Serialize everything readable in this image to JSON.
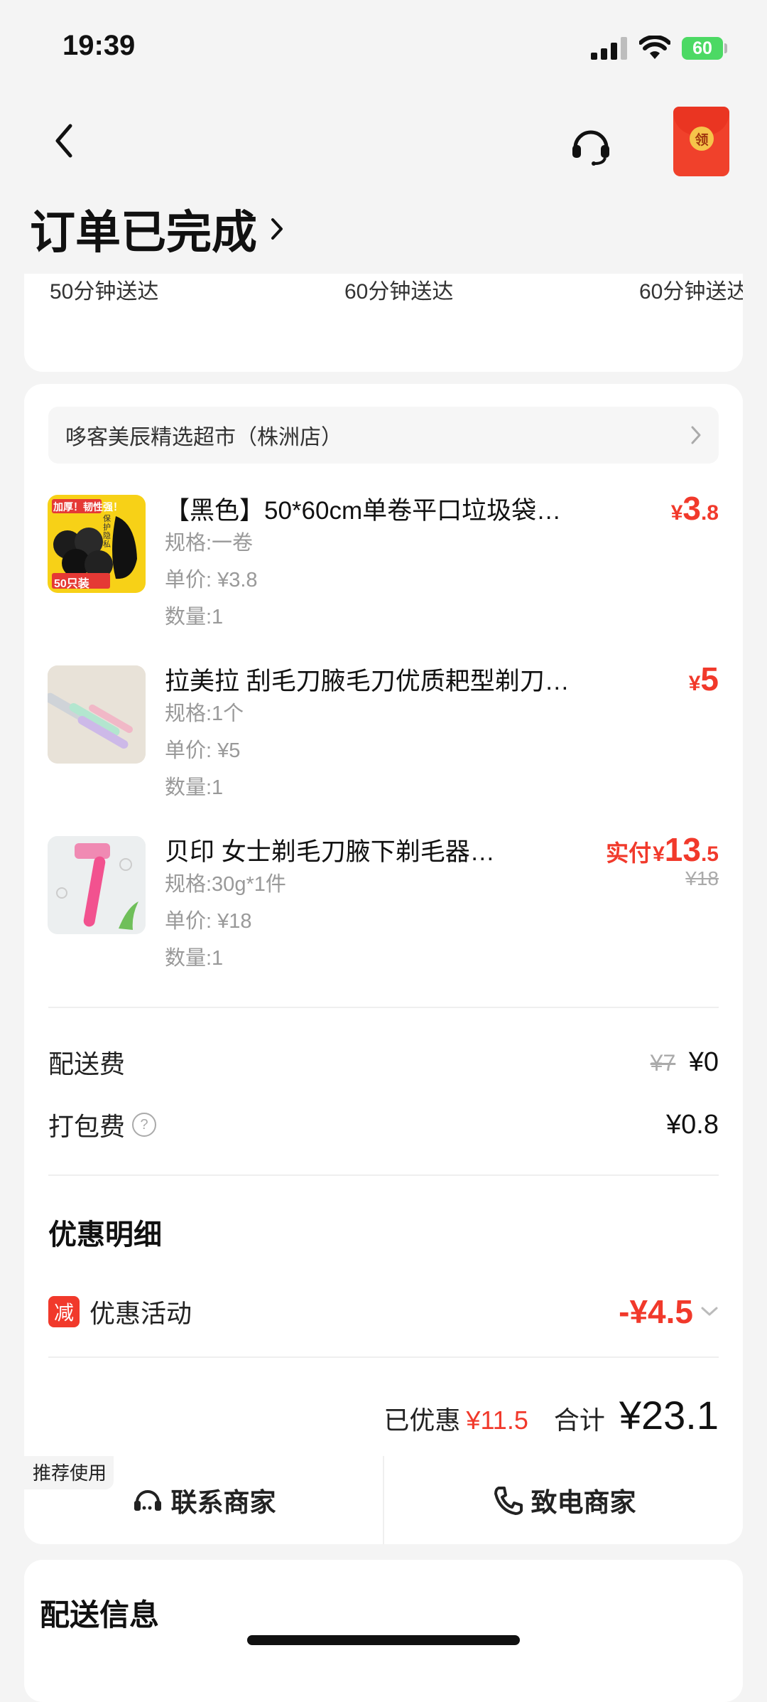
{
  "status_bar": {
    "time": "19:39",
    "battery": "60"
  },
  "header": {
    "title": "订单已完成",
    "redpacket_label": "领",
    "icons": {
      "back": "chevron-left-icon",
      "support": "headset-icon",
      "redpacket": "red-packet-icon"
    }
  },
  "delivery_options": [
    "50分钟送达",
    "60分钟送达",
    "60分钟送达"
  ],
  "store": {
    "name": "哆客美辰精选超市（株洲店）"
  },
  "items": [
    {
      "name": "【黑色】50*60cm单卷平口垃圾袋…",
      "spec": "规格:一卷",
      "unit_price": "单价: ¥3.8",
      "qty": "数量:1",
      "price_currency": "¥",
      "price_int": "3",
      "price_dec": ".8",
      "thumb_texts": [
        "加厚！韧性强！",
        "保护隐私",
        "50只装"
      ]
    },
    {
      "name": "拉美拉 刮毛刀腋毛刀优质耙型剃刀…",
      "spec": "规格:1个",
      "unit_price": "单价: ¥5",
      "qty": "数量:1",
      "price_currency": "¥",
      "price_int": "5",
      "price_dec": ""
    },
    {
      "name": "贝印 女士剃毛刀腋下剃毛器…",
      "spec": "规格:30g*1件",
      "unit_price": "单价: ¥18",
      "qty": "数量:1",
      "price_prefix": "实付",
      "price_currency": "¥",
      "price_int": "13",
      "price_dec": ".5",
      "original_price": "¥18"
    }
  ],
  "fees": {
    "delivery_label": "配送费",
    "delivery_original": "¥7",
    "delivery_value": "¥0",
    "packing_label": "打包费",
    "packing_help": "?",
    "packing_value": "¥0.8"
  },
  "discount": {
    "title": "优惠明细",
    "badge": "减",
    "activity_label": "优惠活动",
    "activity_value": "-¥4.5"
  },
  "totals": {
    "saved_label": "已优惠",
    "saved_value": "¥11.5",
    "total_label": "合计",
    "total_value": "¥23.1"
  },
  "actions": {
    "recommended_tag": "推荐使用",
    "contact_label": "联系商家",
    "call_label": "致电商家"
  },
  "delivery_info": {
    "title": "配送信息"
  },
  "colors": {
    "accent": "#f1392b",
    "background": "#f4f4f4",
    "battery": "#4cd964"
  }
}
